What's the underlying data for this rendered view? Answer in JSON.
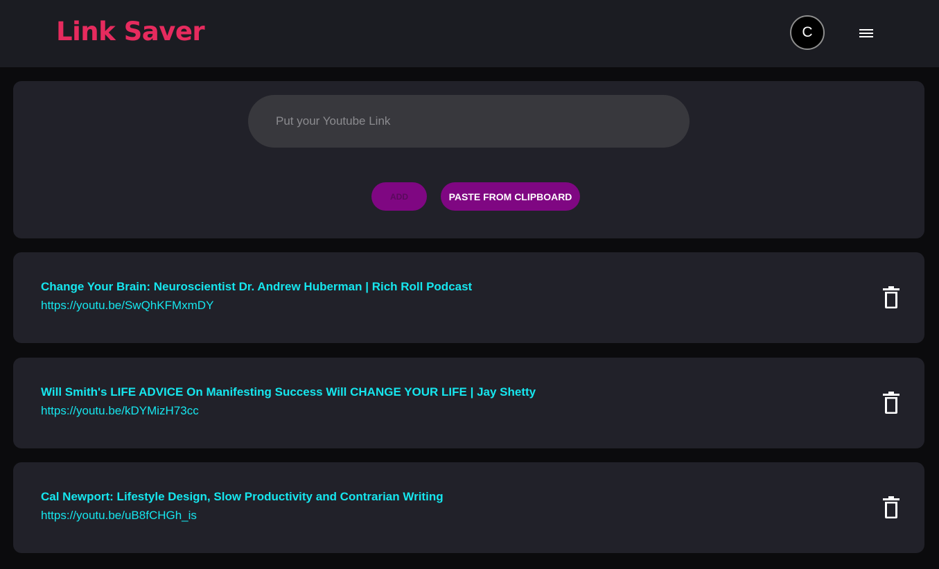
{
  "app": {
    "title": "Link Saver",
    "brand_color": "#e62b5e"
  },
  "header": {
    "avatar_letter": "C",
    "avatar_icon": "avatar",
    "menu_icon": "hamburger-menu-icon"
  },
  "input_panel": {
    "link_placeholder": "Put your Youtube Link",
    "link_value": "",
    "add_label": "ADD",
    "paste_label": "PASTE FROM CLIPBOARD",
    "button_color": "#7f0782"
  },
  "links": [
    {
      "title": "Change Your Brain: Neuroscientist Dr. Andrew Huberman | Rich Roll Podcast",
      "url": "https://youtu.be/SwQhKFMxmDY",
      "delete_icon": "trash-icon"
    },
    {
      "title": "Will Smith's LIFE ADVICE On Manifesting Success Will CHANGE YOUR LIFE | Jay Shetty",
      "url": "https://youtu.be/kDYMizH73cc",
      "delete_icon": "trash-icon"
    },
    {
      "title": "Cal Newport: Lifestyle Design, Slow Productivity and Contrarian Writing",
      "url": "https://youtu.be/uB8fCHGh_is",
      "delete_icon": "trash-icon"
    }
  ],
  "link_text_color": "#16e6ee"
}
